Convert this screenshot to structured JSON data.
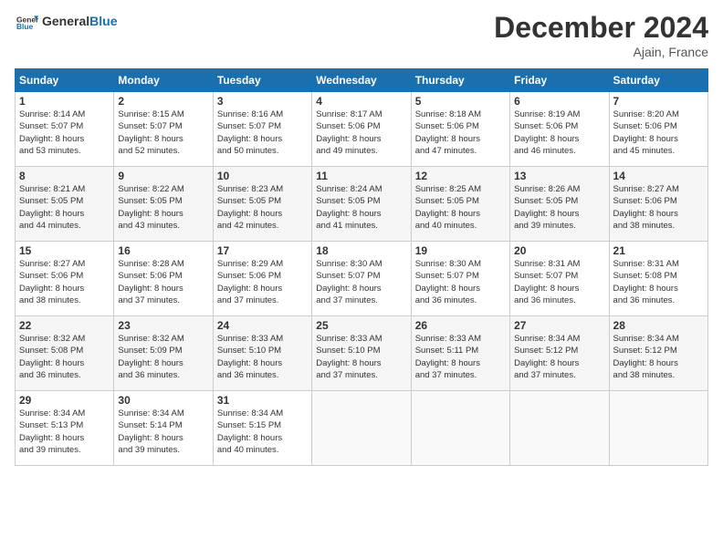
{
  "logo": {
    "text_general": "General",
    "text_blue": "Blue"
  },
  "header": {
    "month_title": "December 2024",
    "subtitle": "Ajain, France"
  },
  "weekdays": [
    "Sunday",
    "Monday",
    "Tuesday",
    "Wednesday",
    "Thursday",
    "Friday",
    "Saturday"
  ],
  "weeks": [
    [
      {
        "day": "1",
        "sunrise": "8:14 AM",
        "sunset": "5:07 PM",
        "daylight": "8 hours and 53 minutes."
      },
      {
        "day": "2",
        "sunrise": "8:15 AM",
        "sunset": "5:07 PM",
        "daylight": "8 hours and 52 minutes."
      },
      {
        "day": "3",
        "sunrise": "8:16 AM",
        "sunset": "5:07 PM",
        "daylight": "8 hours and 50 minutes."
      },
      {
        "day": "4",
        "sunrise": "8:17 AM",
        "sunset": "5:06 PM",
        "daylight": "8 hours and 49 minutes."
      },
      {
        "day": "5",
        "sunrise": "8:18 AM",
        "sunset": "5:06 PM",
        "daylight": "8 hours and 47 minutes."
      },
      {
        "day": "6",
        "sunrise": "8:19 AM",
        "sunset": "5:06 PM",
        "daylight": "8 hours and 46 minutes."
      },
      {
        "day": "7",
        "sunrise": "8:20 AM",
        "sunset": "5:06 PM",
        "daylight": "8 hours and 45 minutes."
      }
    ],
    [
      {
        "day": "8",
        "sunrise": "8:21 AM",
        "sunset": "5:05 PM",
        "daylight": "8 hours and 44 minutes."
      },
      {
        "day": "9",
        "sunrise": "8:22 AM",
        "sunset": "5:05 PM",
        "daylight": "8 hours and 43 minutes."
      },
      {
        "day": "10",
        "sunrise": "8:23 AM",
        "sunset": "5:05 PM",
        "daylight": "8 hours and 42 minutes."
      },
      {
        "day": "11",
        "sunrise": "8:24 AM",
        "sunset": "5:05 PM",
        "daylight": "8 hours and 41 minutes."
      },
      {
        "day": "12",
        "sunrise": "8:25 AM",
        "sunset": "5:05 PM",
        "daylight": "8 hours and 40 minutes."
      },
      {
        "day": "13",
        "sunrise": "8:26 AM",
        "sunset": "5:05 PM",
        "daylight": "8 hours and 39 minutes."
      },
      {
        "day": "14",
        "sunrise": "8:27 AM",
        "sunset": "5:06 PM",
        "daylight": "8 hours and 38 minutes."
      }
    ],
    [
      {
        "day": "15",
        "sunrise": "8:27 AM",
        "sunset": "5:06 PM",
        "daylight": "8 hours and 38 minutes."
      },
      {
        "day": "16",
        "sunrise": "8:28 AM",
        "sunset": "5:06 PM",
        "daylight": "8 hours and 37 minutes."
      },
      {
        "day": "17",
        "sunrise": "8:29 AM",
        "sunset": "5:06 PM",
        "daylight": "8 hours and 37 minutes."
      },
      {
        "day": "18",
        "sunrise": "8:30 AM",
        "sunset": "5:07 PM",
        "daylight": "8 hours and 37 minutes."
      },
      {
        "day": "19",
        "sunrise": "8:30 AM",
        "sunset": "5:07 PM",
        "daylight": "8 hours and 36 minutes."
      },
      {
        "day": "20",
        "sunrise": "8:31 AM",
        "sunset": "5:07 PM",
        "daylight": "8 hours and 36 minutes."
      },
      {
        "day": "21",
        "sunrise": "8:31 AM",
        "sunset": "5:08 PM",
        "daylight": "8 hours and 36 minutes."
      }
    ],
    [
      {
        "day": "22",
        "sunrise": "8:32 AM",
        "sunset": "5:08 PM",
        "daylight": "8 hours and 36 minutes."
      },
      {
        "day": "23",
        "sunrise": "8:32 AM",
        "sunset": "5:09 PM",
        "daylight": "8 hours and 36 minutes."
      },
      {
        "day": "24",
        "sunrise": "8:33 AM",
        "sunset": "5:10 PM",
        "daylight": "8 hours and 36 minutes."
      },
      {
        "day": "25",
        "sunrise": "8:33 AM",
        "sunset": "5:10 PM",
        "daylight": "8 hours and 37 minutes."
      },
      {
        "day": "26",
        "sunrise": "8:33 AM",
        "sunset": "5:11 PM",
        "daylight": "8 hours and 37 minutes."
      },
      {
        "day": "27",
        "sunrise": "8:34 AM",
        "sunset": "5:12 PM",
        "daylight": "8 hours and 37 minutes."
      },
      {
        "day": "28",
        "sunrise": "8:34 AM",
        "sunset": "5:12 PM",
        "daylight": "8 hours and 38 minutes."
      }
    ],
    [
      {
        "day": "29",
        "sunrise": "8:34 AM",
        "sunset": "5:13 PM",
        "daylight": "8 hours and 39 minutes."
      },
      {
        "day": "30",
        "sunrise": "8:34 AM",
        "sunset": "5:14 PM",
        "daylight": "8 hours and 39 minutes."
      },
      {
        "day": "31",
        "sunrise": "8:34 AM",
        "sunset": "5:15 PM",
        "daylight": "8 hours and 40 minutes."
      },
      null,
      null,
      null,
      null
    ]
  ]
}
